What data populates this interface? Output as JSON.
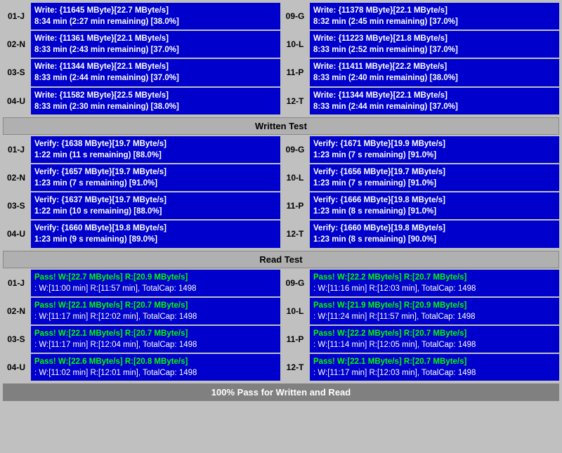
{
  "sections": {
    "write_test": {
      "header": "Written Test",
      "rows": [
        {
          "left_label": "01-J",
          "left_line1": "Write: {11645 MByte}[22.7 MByte/s]",
          "left_line2": "8:34 min (2:27 min remaining)  [38.0%]",
          "right_label": "09-G",
          "right_line1": "Write: {11378 MByte}[22.1 MByte/s]",
          "right_line2": "8:32 min (2:45 min remaining)  [37.0%]"
        },
        {
          "left_label": "02-N",
          "left_line1": "Write: {11361 MByte}[22.1 MByte/s]",
          "left_line2": "8:33 min (2:43 min remaining)  [37.0%]",
          "right_label": "10-L",
          "right_line1": "Write: {11223 MByte}[21.8 MByte/s]",
          "right_line2": "8:33 min (2:52 min remaining)  [37.0%]"
        },
        {
          "left_label": "03-S",
          "left_line1": "Write: {11344 MByte}[22.1 MByte/s]",
          "left_line2": "8:33 min (2:44 min remaining)  [37.0%]",
          "right_label": "11-P",
          "right_line1": "Write: {11411 MByte}[22.2 MByte/s]",
          "right_line2": "8:33 min (2:40 min remaining)  [38.0%]"
        },
        {
          "left_label": "04-U",
          "left_line1": "Write: {11582 MByte}[22.5 MByte/s]",
          "left_line2": "8:33 min (2:30 min remaining)  [38.0%]",
          "right_label": "12-T",
          "right_line1": "Write: {11344 MByte}[22.1 MByte/s]",
          "right_line2": "8:33 min (2:44 min remaining)  [37.0%]"
        }
      ]
    },
    "verify_test": {
      "header": "Written Test",
      "rows": [
        {
          "left_label": "01-J",
          "left_line1": "Verify: {1638 MByte}[19.7 MByte/s]",
          "left_line2": "1:22 min (11 s remaining)   [88.0%]",
          "right_label": "09-G",
          "right_line1": "Verify: {1671 MByte}[19.9 MByte/s]",
          "right_line2": "1:23 min (7 s remaining)   [91.0%]"
        },
        {
          "left_label": "02-N",
          "left_line1": "Verify: {1657 MByte}[19.7 MByte/s]",
          "left_line2": "1:23 min (7 s remaining)   [91.0%]",
          "right_label": "10-L",
          "right_line1": "Verify: {1656 MByte}[19.7 MByte/s]",
          "right_line2": "1:23 min (7 s remaining)   [91.0%]"
        },
        {
          "left_label": "03-S",
          "left_line1": "Verify: {1637 MByte}[19.7 MByte/s]",
          "left_line2": "1:22 min (10 s remaining)   [88.0%]",
          "right_label": "11-P",
          "right_line1": "Verify: {1666 MByte}[19.8 MByte/s]",
          "right_line2": "1:23 min (8 s remaining)   [91.0%]"
        },
        {
          "left_label": "04-U",
          "left_line1": "Verify: {1660 MByte}[19.8 MByte/s]",
          "left_line2": "1:23 min (9 s remaining)   [89.0%]",
          "right_label": "12-T",
          "right_line1": "Verify: {1660 MByte}[19.8 MByte/s]",
          "right_line2": "1:23 min (8 s remaining)   [90.0%]"
        }
      ]
    },
    "read_test": {
      "header": "Read Test",
      "rows": [
        {
          "left_label": "01-J",
          "left_line1": "Pass! W:[22.7 MByte/s] R:[20.9 MByte/s]",
          "left_line2": ": W:[11:00 min] R:[11:57 min], TotalCap: 1498",
          "right_label": "09-G",
          "right_line1": "Pass! W:[22.2 MByte/s] R:[20.7 MByte/s]",
          "right_line2": ": W:[11:16 min] R:[12:03 min], TotalCap: 1498"
        },
        {
          "left_label": "02-N",
          "left_line1": "Pass! W:[22.1 MByte/s] R:[20.7 MByte/s]",
          "left_line2": ": W:[11:17 min] R:[12:02 min], TotalCap: 1498",
          "right_label": "10-L",
          "right_line1": "Pass! W:[21.9 MByte/s] R:[20.9 MByte/s]",
          "right_line2": ": W:[11:24 min] R:[11:57 min], TotalCap: 1498"
        },
        {
          "left_label": "03-S",
          "left_line1": "Pass! W:[22.1 MByte/s] R:[20.7 MByte/s]",
          "left_line2": ": W:[11:17 min] R:[12:04 min], TotalCap: 1498",
          "right_label": "11-P",
          "right_line1": "Pass! W:[22.2 MByte/s] R:[20.7 MByte/s]",
          "right_line2": ": W:[11:14 min] R:[12:05 min], TotalCap: 1498"
        },
        {
          "left_label": "04-U",
          "left_line1": "Pass! W:[22.6 MByte/s] R:[20.8 MByte/s]",
          "left_line2": ": W:[11:02 min] R:[12:01 min], TotalCap: 1498",
          "right_label": "12-T",
          "right_line1": "Pass! W:[22.1 MByte/s] R:[20.7 MByte/s]",
          "right_line2": ": W:[11:17 min] R:[12:03 min], TotalCap: 1498"
        }
      ]
    },
    "footer": "100% Pass for Written and Read"
  }
}
